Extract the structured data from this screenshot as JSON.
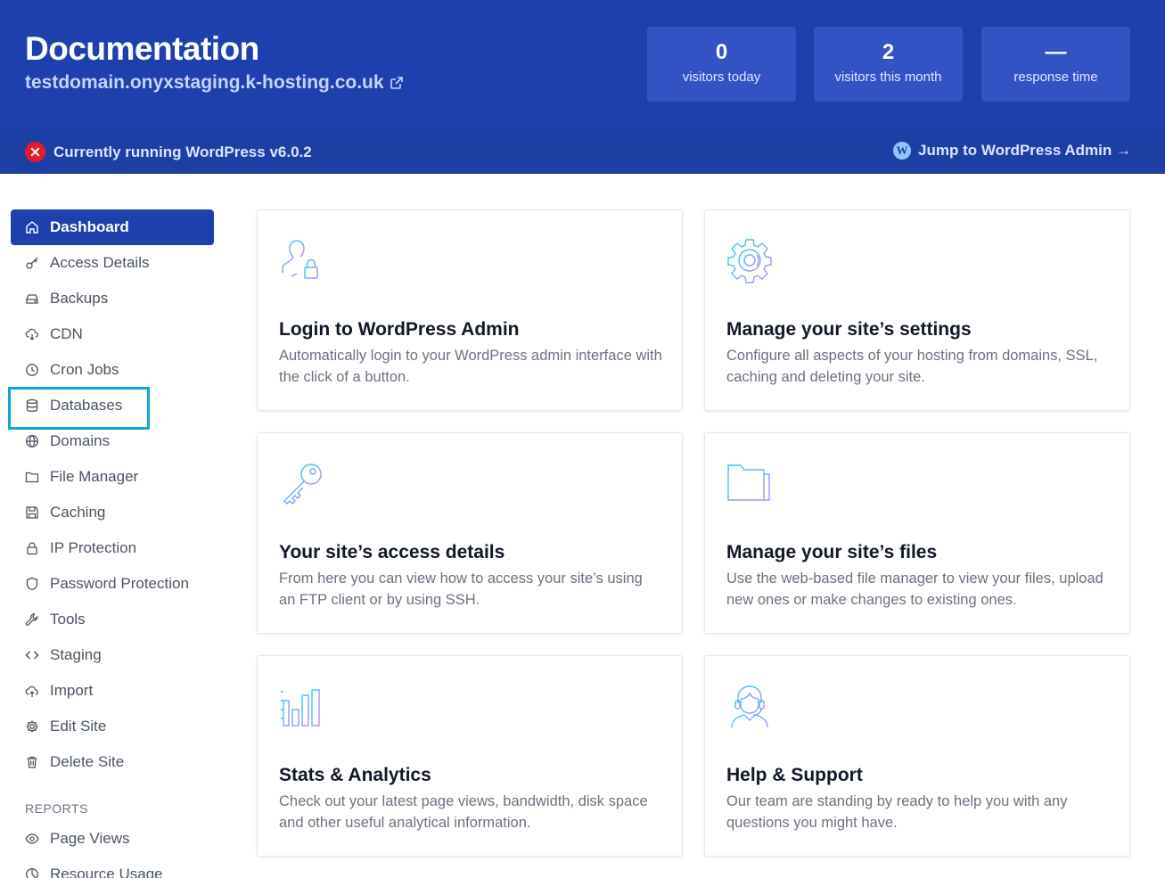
{
  "site": {
    "title": "Documentation",
    "domain": "testdomain.onyxstaging.k-hosting.co.uk"
  },
  "stats": [
    {
      "value": "0",
      "label": "visitors today"
    },
    {
      "value": "2",
      "label": "visitors this month"
    },
    {
      "value": "—",
      "label": "response time"
    }
  ],
  "status": {
    "wordpress_text": "Currently running WordPress v6.0.2",
    "admin_link": "Jump to WordPress Admin →"
  },
  "sidebar": {
    "items": [
      {
        "label": "Dashboard",
        "icon": "home-icon"
      },
      {
        "label": "Access Details",
        "icon": "key-icon"
      },
      {
        "label": "Backups",
        "icon": "drive-icon"
      },
      {
        "label": "CDN",
        "icon": "cloud-download-icon"
      },
      {
        "label": "Cron Jobs",
        "icon": "clock-icon"
      },
      {
        "label": "Databases",
        "icon": "database-icon"
      },
      {
        "label": "Domains",
        "icon": "globe-icon"
      },
      {
        "label": "File Manager",
        "icon": "folder-icon"
      },
      {
        "label": "Caching",
        "icon": "save-icon"
      },
      {
        "label": "IP Protection",
        "icon": "lock-icon"
      },
      {
        "label": "Password Protection",
        "icon": "shield-icon"
      },
      {
        "label": "Tools",
        "icon": "wrench-icon"
      },
      {
        "label": "Staging",
        "icon": "code-icon"
      },
      {
        "label": "Import",
        "icon": "cloud-upload-icon"
      },
      {
        "label": "Edit Site",
        "icon": "gear-icon"
      },
      {
        "label": "Delete Site",
        "icon": "trash-icon"
      }
    ],
    "reports_heading": "REPORTS",
    "report_items": [
      {
        "label": "Page Views",
        "icon": "eye-icon"
      },
      {
        "label": "Resource Usage",
        "icon": "chart-icon"
      }
    ]
  },
  "cards": [
    {
      "title": "Login to WordPress Admin",
      "desc": "Automatically login to your WordPress admin interface with the click of a button.",
      "icon": "user-lock-icon"
    },
    {
      "title": "Manage your site’s settings",
      "desc": "Configure all aspects of your hosting from domains, SSL, caching and deleting your site.",
      "icon": "gear-icon"
    },
    {
      "title": "Your site’s access details",
      "desc": "From here you can view how to access your site’s using an FTP client or by using SSH.",
      "icon": "key-icon"
    },
    {
      "title": "Manage your site’s files",
      "desc": "Use the web-based file manager to view your files, upload new ones or make changes to existing ones.",
      "icon": "folder-icon"
    },
    {
      "title": "Stats & Analytics",
      "desc": "Check out your latest page views, bandwidth, disk space and other useful analytical information.",
      "icon": "bar-chart-icon"
    },
    {
      "title": "Help & Support",
      "desc": "Our team are standing by ready to help you with any questions you might have.",
      "icon": "support-agent-icon"
    }
  ],
  "colors": {
    "brand": "#1e40af",
    "accent_gradient_start": "#22d3ee",
    "accent_gradient_end": "#c084fc",
    "error": "#e11d2a",
    "highlight": "#0ea5d9"
  }
}
